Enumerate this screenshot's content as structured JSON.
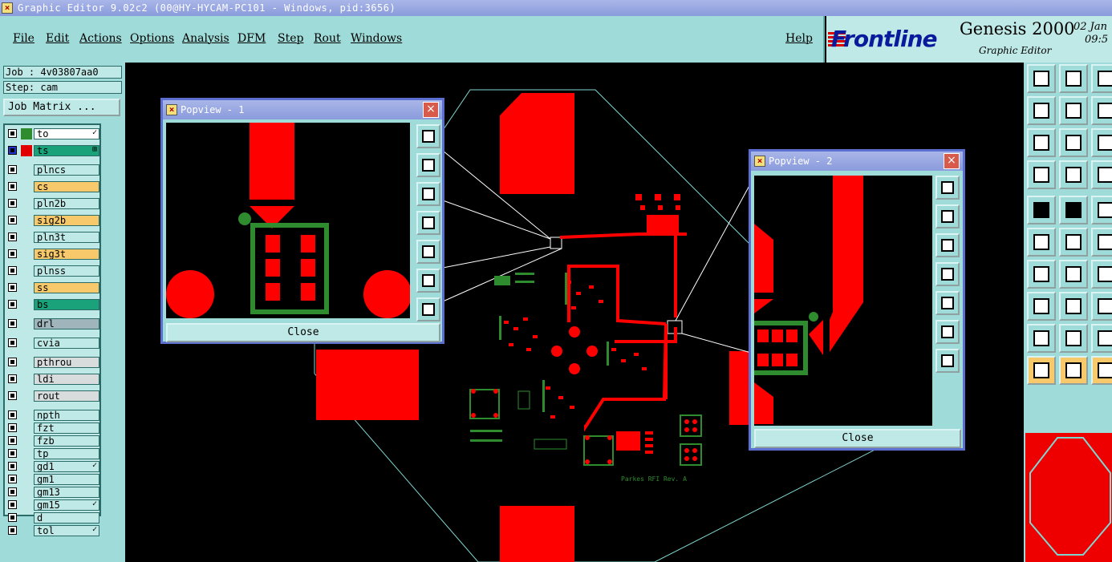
{
  "window": {
    "title": "Graphic Editor 9.02c2 (00@HY-HYCAM-PC101 - Windows, pid:3656)"
  },
  "menu": {
    "items": [
      "File",
      "Edit",
      "Actions",
      "Options",
      "Analysis",
      "DFM",
      "Step",
      "Rout",
      "Windows"
    ],
    "help": "Help"
  },
  "brand": {
    "logo": "Frontline",
    "product": "Genesis 2000",
    "subtitle": "Graphic Editor",
    "date": "02 Jan",
    "time": "09:5"
  },
  "job": {
    "label": "Job : 4v03807aa0",
    "step": "Step: cam",
    "matrix_button": "Job Matrix ..."
  },
  "layers": [
    {
      "name": "to",
      "color": "#ffffff",
      "swatch": "#2e8b2e",
      "mark": "✓"
    },
    {
      "name": "ts",
      "color": "#1aa37a",
      "swatch": "#e00000",
      "mark": "⊞"
    },
    {
      "name": "plncs",
      "color": "#bfe9e6",
      "swatch": "",
      "mark": ""
    },
    {
      "name": "cs",
      "color": "#f7c96b",
      "swatch": "",
      "mark": ""
    },
    {
      "name": "pln2b",
      "color": "#bfe9e6",
      "swatch": "",
      "mark": ""
    },
    {
      "name": "sig2b",
      "color": "#f7c96b",
      "swatch": "",
      "mark": ""
    },
    {
      "name": "pln3t",
      "color": "#bfe9e6",
      "swatch": "",
      "mark": ""
    },
    {
      "name": "sig3t",
      "color": "#f7c96b",
      "swatch": "",
      "mark": ""
    },
    {
      "name": "plnss",
      "color": "#bfe9e6",
      "swatch": "",
      "mark": ""
    },
    {
      "name": "ss",
      "color": "#f7c96b",
      "swatch": "",
      "mark": ""
    },
    {
      "name": "bs",
      "color": "#1aa37a",
      "swatch": "",
      "mark": ""
    },
    {
      "name": "drl",
      "color": "#9fb4bb",
      "swatch": "",
      "mark": ""
    },
    {
      "name": "cvia",
      "color": "#bfe9e6",
      "swatch": "",
      "mark": ""
    },
    {
      "name": "pthrou",
      "color": "#d8dcdc",
      "swatch": "",
      "mark": ""
    },
    {
      "name": "ldi",
      "color": "#d8dcdc",
      "swatch": "",
      "mark": ""
    },
    {
      "name": "rout",
      "color": "#d8dcdc",
      "swatch": "",
      "mark": ""
    },
    {
      "name": "npth",
      "color": "#bfe9e6",
      "swatch": "",
      "mark": ""
    },
    {
      "name": "fzt",
      "color": "#bfe9e6",
      "swatch": "",
      "mark": ""
    },
    {
      "name": "fzb",
      "color": "#bfe9e6",
      "swatch": "",
      "mark": ""
    },
    {
      "name": "tp",
      "color": "#bfe9e6",
      "swatch": "",
      "mark": ""
    },
    {
      "name": "gd1",
      "color": "#bfe9e6",
      "swatch": "",
      "mark": "✓"
    },
    {
      "name": "gm1",
      "color": "#bfe9e6",
      "swatch": "",
      "mark": ""
    },
    {
      "name": "gm13",
      "color": "#bfe9e6",
      "swatch": "",
      "mark": ""
    },
    {
      "name": "gm15",
      "color": "#bfe9e6",
      "swatch": "",
      "mark": "✓"
    },
    {
      "name": "d",
      "color": "#bfe9e6",
      "swatch": "",
      "mark": ""
    },
    {
      "name": "tol",
      "color": "#bfe9e6",
      "swatch": "",
      "mark": "✓"
    }
  ],
  "popview1": {
    "title": "Popview - 1",
    "close": "Close"
  },
  "popview2": {
    "title": "Popview - 2",
    "close": "Close"
  },
  "board": {
    "label": "Parkes RFI Rev. A"
  },
  "colors": {
    "copper": "#ff0000",
    "silk": "#2e8b2e",
    "panel": "#9fdcd9",
    "outline": "#7fd6d0"
  }
}
